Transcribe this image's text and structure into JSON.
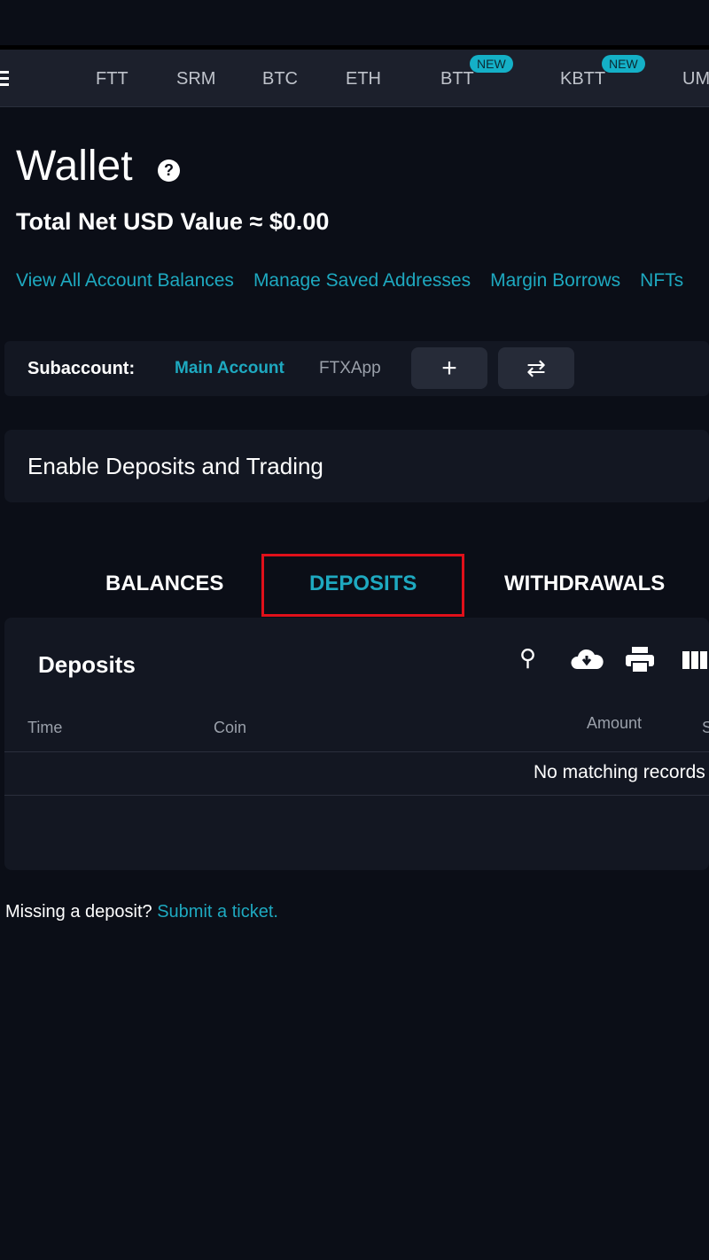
{
  "ticker": {
    "items": [
      "FTT",
      "SRM",
      "BTC",
      "ETH",
      "BTT",
      "KBTT",
      "UMEE"
    ],
    "badge": "NEW"
  },
  "wallet": {
    "title": "Wallet",
    "help": "?",
    "total": "Total Net USD Value ≈ $0.00"
  },
  "links": [
    "View All Account Balances",
    "Manage Saved Addresses",
    "Margin Borrows",
    "NFTs"
  ],
  "subaccount": {
    "label": "Subaccount:",
    "main": "Main Account",
    "other": "FTXApp",
    "add": "+",
    "transfer": "⇄"
  },
  "enable": "Enable Deposits and Trading",
  "tabs": [
    "BALANCES",
    "DEPOSITS",
    "WITHDRAWALS"
  ],
  "deposits": {
    "title": "Deposits",
    "columns": [
      "Time",
      "Coin",
      "Amount",
      "Status"
    ],
    "empty": "No matching records found"
  },
  "footer": {
    "text": "Missing a deposit?",
    "link": "Submit a ticket."
  },
  "colors": {
    "accent": "#1ea9c0",
    "highlight": "#e0101a"
  }
}
